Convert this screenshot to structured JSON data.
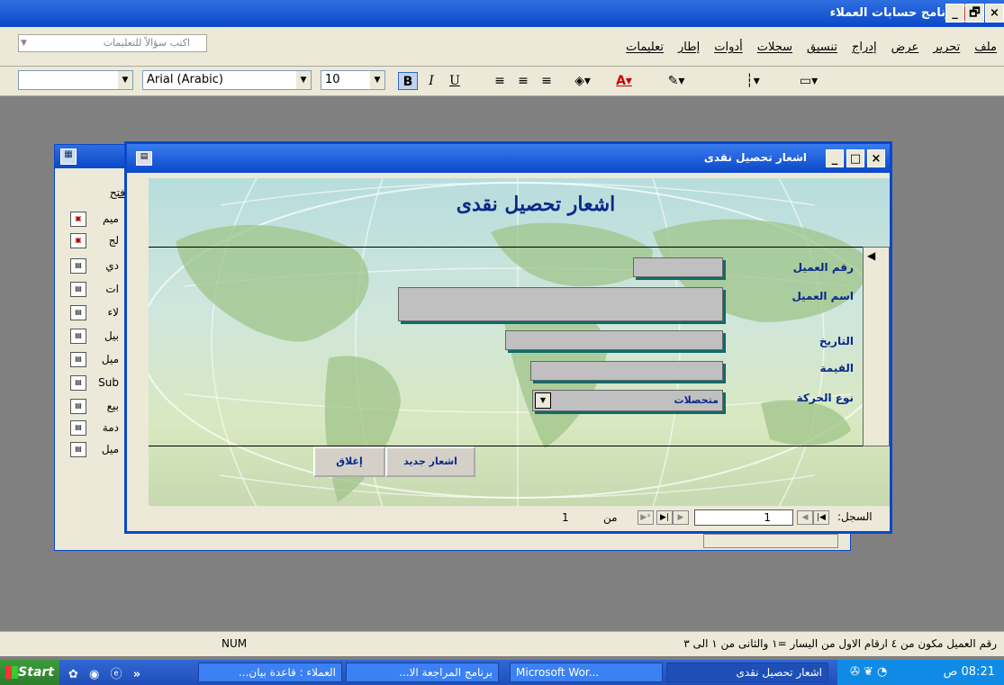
{
  "app": {
    "title": "برنامج حسابات العملاء"
  },
  "window_controls": {
    "minimize": "_",
    "maximize": "🗗",
    "close": "×"
  },
  "menu": {
    "items": [
      "ملف",
      "تحرير",
      "عرض",
      "إدراج",
      "تنسيق",
      "سجلات",
      "أدوات",
      "إطار",
      "تعليمات"
    ]
  },
  "help_box": {
    "placeholder": "اكتب سؤالاً للتعليمات"
  },
  "format_toolbar": {
    "font_name": "Arial (Arabic)",
    "font_size": "10",
    "bold": "B",
    "italic": "I",
    "underline": "U"
  },
  "db_window": {
    "open_label": "فتح",
    "items": [
      {
        "icon": "report-icon",
        "label": "ميم"
      },
      {
        "icon": "report-icon",
        "label": "لج"
      },
      {
        "icon": "form-icon",
        "label": "دي"
      },
      {
        "icon": "form-icon",
        "label": "ات"
      },
      {
        "icon": "form-icon",
        "label": "لاء"
      },
      {
        "icon": "form-icon",
        "label": "بيل"
      },
      {
        "icon": "form-icon",
        "label": "ميل"
      },
      {
        "icon": "form-icon",
        "label": "Sub"
      },
      {
        "icon": "form-icon",
        "label": "بيع"
      },
      {
        "icon": "form-icon",
        "label": "دمة"
      },
      {
        "icon": "form-icon",
        "label": "ميل"
      }
    ]
  },
  "form": {
    "window_title": "اشعار تحصيل نقدى",
    "heading": "اشعار تحصيل نقدى",
    "labels": {
      "customer_no": "رقم العميل",
      "customer_name": "اسم العميل",
      "date": "التاريخ",
      "value": "القيمة",
      "movement_type": "نوع الحركة"
    },
    "movement_type_value": "متحصلات",
    "buttons": {
      "new_notice": "اشعار جديد",
      "close": "إغلاق"
    },
    "navigation": {
      "record_label": "السجل:",
      "current": "1",
      "of_label": "من",
      "total": "1"
    }
  },
  "status_bar": {
    "message": "رقم العميل مكون من ٤ ارقام الاول  من اليسار =١ والثانى من ١ الى ٣",
    "num": "NUM"
  },
  "taskbar": {
    "start": "Start",
    "tasks": [
      "اشعار تحصيل نقدى",
      "Microsoft Wor...",
      "برنامج المراجعة الا...",
      "العملاء : قاعدة بيان..."
    ],
    "clock": "08:21 ص"
  }
}
